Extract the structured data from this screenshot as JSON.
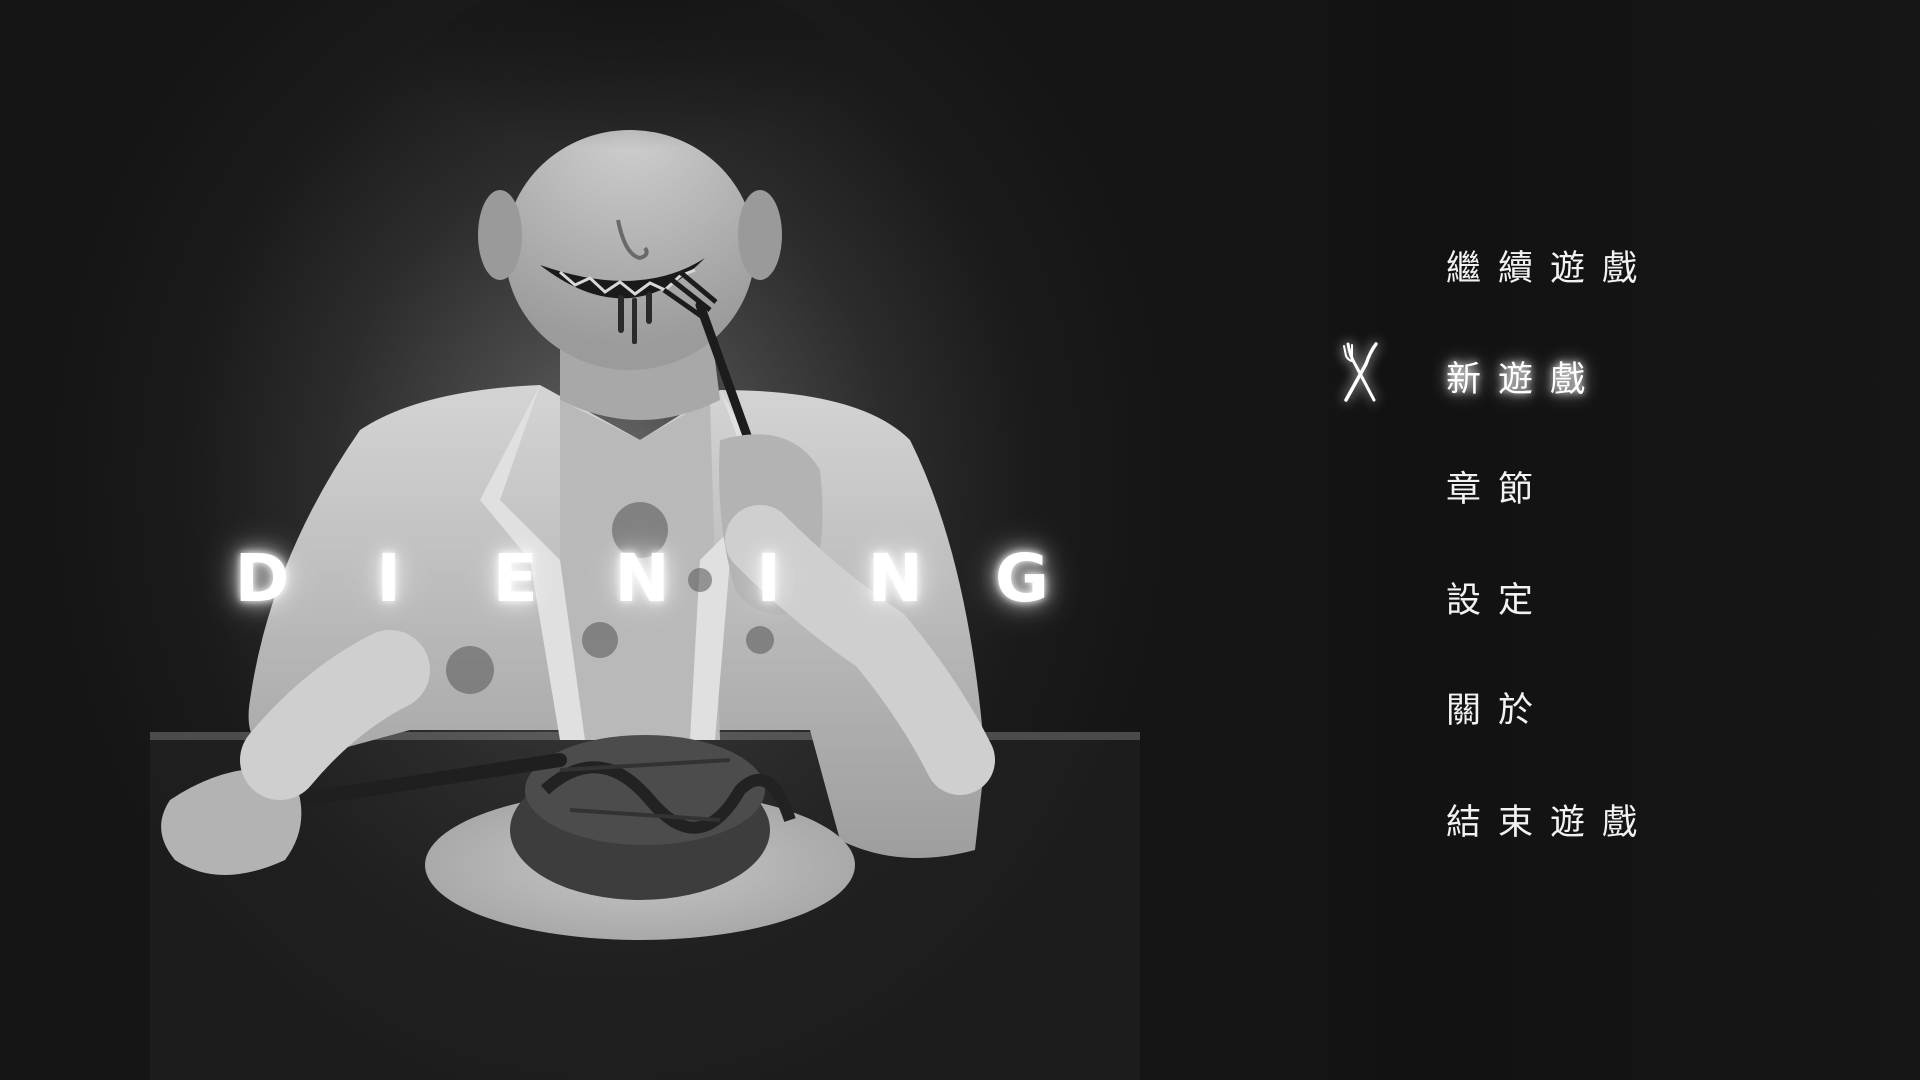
{
  "title": {
    "letters": [
      "D",
      "I",
      "E",
      "N",
      "I",
      "N",
      "G"
    ]
  },
  "menu": {
    "items": [
      {
        "label": "繼續遊戲"
      },
      {
        "label": "新遊戲"
      },
      {
        "label": "章節"
      },
      {
        "label": "設定"
      },
      {
        "label": "關於"
      },
      {
        "label": "結束遊戲"
      }
    ],
    "selected_label": "新遊戲",
    "cursor_icon": "fork-and-knife-icon"
  },
  "colors": {
    "background": "#141414",
    "menu_text": "#f2f2f2",
    "glow": "#ffffff"
  }
}
